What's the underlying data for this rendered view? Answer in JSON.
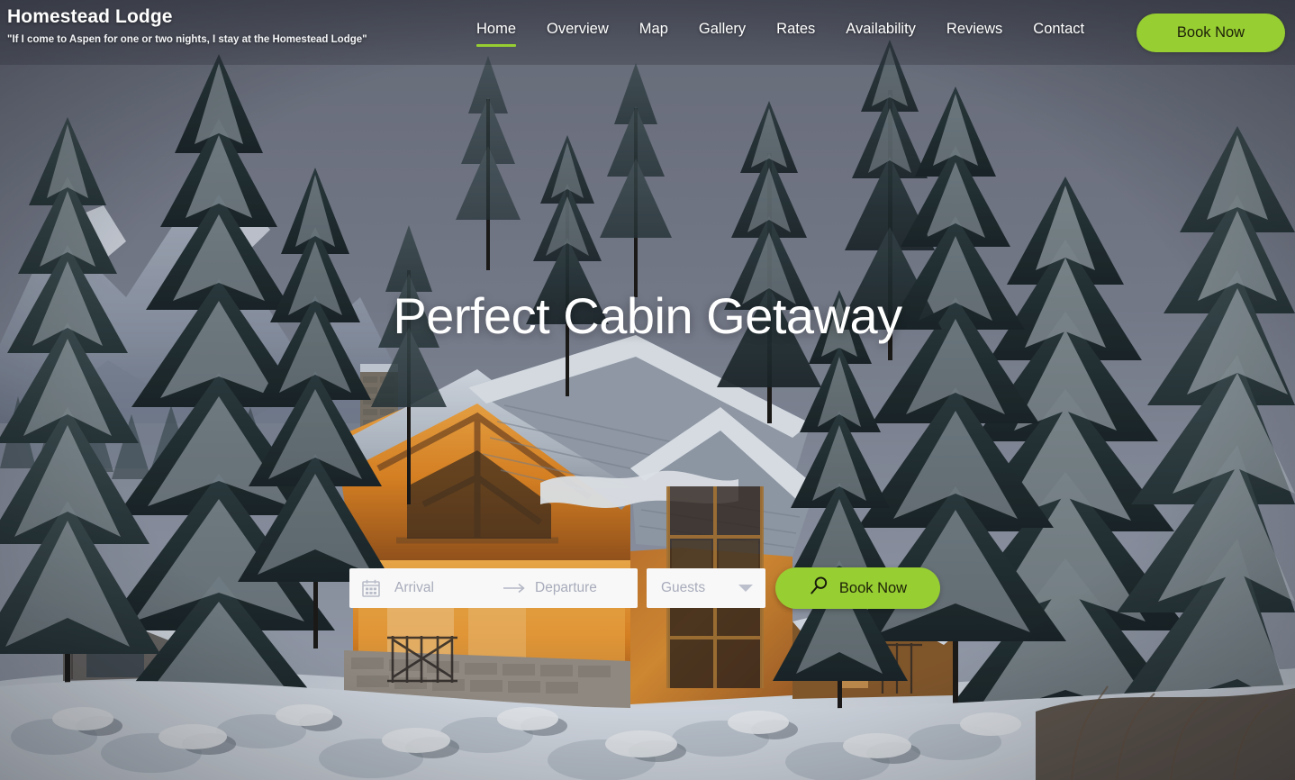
{
  "brand": {
    "name": "Homestead Lodge",
    "tagline": "\"If I come to Aspen for one or two nights, I stay at the Homestead Lodge\""
  },
  "nav": {
    "items": [
      {
        "label": "Home",
        "active": true
      },
      {
        "label": "Overview",
        "active": false
      },
      {
        "label": "Map",
        "active": false
      },
      {
        "label": "Gallery",
        "active": false
      },
      {
        "label": "Rates",
        "active": false
      },
      {
        "label": "Availability",
        "active": false
      },
      {
        "label": "Reviews",
        "active": false
      },
      {
        "label": "Contact",
        "active": false
      }
    ]
  },
  "header_cta": {
    "label": "Book Now"
  },
  "hero": {
    "title": "Perfect Cabin Getaway"
  },
  "booking": {
    "arrival_placeholder": "Arrival",
    "departure_placeholder": "Departure",
    "guests_placeholder": "Guests",
    "submit_label": "Book Now",
    "calendar_icon": "calendar-icon",
    "arrow_icon": "arrow-right-icon",
    "caret_icon": "chevron-down-icon",
    "search_icon": "search-icon"
  },
  "colors": {
    "accent_green": "#97ce32",
    "field_bg": "#f8f8f8",
    "placeholder": "#a8acbb",
    "header_scrim": "#6a6e7d"
  }
}
